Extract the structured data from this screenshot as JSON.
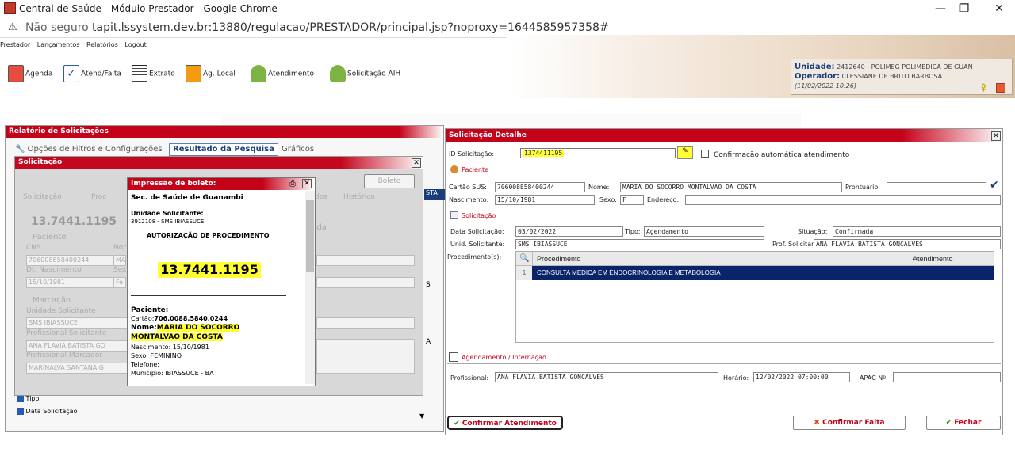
{
  "browser": {
    "window_title": "Central de Saúde - Módulo Prestador - Google Chrome",
    "not_secure": "Não seguro",
    "url": "tapit.lssystem.dev.br:13880/regulacao/PRESTADOR/principal.jsp?noproxy=1644585957358#"
  },
  "menu": {
    "items": [
      "Prestador",
      "Lançamentos",
      "Relatórios",
      "Logout"
    ]
  },
  "toolbar": {
    "agenda": "Agenda",
    "atend_falta": "Atend/Falta",
    "extrato": "Extrato",
    "ag_local": "Ag. Local",
    "atendimento": "Atendimento",
    "solicitacao_aih": "Solicitação AIH"
  },
  "unit": {
    "unidade_label": "Unidade:",
    "unidade_value": "2412640 - POLIMEG POLIMEDICA DE GUAN",
    "operador_label": "Operador:",
    "operador_value": "CLESSIANE DE BRITO BARBOSA",
    "datetime": "(11/02/2022 10:26)"
  },
  "relatorio": {
    "title": "Relatório de Solicitações",
    "tab_filtros": "Opções de Filtros e Configurações",
    "tab_resultado": "Resultado da Pesquisa",
    "tab_graficos": "Gráficos",
    "chk_tipo": "Tipo",
    "chk_data": "Data Solicitação"
  },
  "solicitacao_modal": {
    "title": "Solicitação",
    "boleto_btn": "Boleto",
    "tab_solicitacao": "Solicitação",
    "tab_proc": "Proc",
    "tab_dos": "dos",
    "tab_historico": "Histórico",
    "number": "13.7441.1195",
    "confirmada": "nfirmada",
    "paciente": "Paciente",
    "cns": "CNS",
    "cns_value": "706008858400244",
    "nome_short": "Nor",
    "nome_value": "MA",
    "dt_nasc": "Dt. Nascimento",
    "sexo_short": "Sex",
    "dt_nasc_value": "15/10/1981",
    "sexo_value": "Fe",
    "marcacao": "Marcação",
    "unid_sol": "Unidade Solicitante",
    "unid_sol_value": "SMS IBIASSUCE",
    "prof_sol": "Profissional Solicitante",
    "prof_sol_value": "ANA FLAVIA BATISTA GO",
    "prof_marc": "Profissional Marcador",
    "prof_marc_value": "MARINALVA SANTANA G"
  },
  "boleto": {
    "title": "Impressão de boleto:",
    "org": "Sec. de Saúde de Guanambi",
    "unid_label": "Unidade Solicitante:",
    "unid_value": "3912108 - SMS IBIASSUCE",
    "autorizacao": "AUTORIZAÇÃO DE PROCEDIMENTO",
    "number": "13.7441.1195",
    "paciente_label": "Paciente:",
    "cartao_label": "Cartão:",
    "cartao_value": "706.0088.5840.0244",
    "nome_label": "Nome:",
    "nome_value1": "MARIA DO SOCORRO",
    "nome_value2": "MONTALVAO DA COSTA",
    "nascimento": "Nascimento: 15/10/1981",
    "sexo": "Sexo: FEMININO",
    "telefone": "Telefone:",
    "municipio": "Municipio: IBIASSUCE - BA"
  },
  "background_fragments": {
    "sta": "STA",
    "s": "S",
    "a": "A"
  },
  "detalhe": {
    "title": "Solicitação Detalhe",
    "id_label": "ID Solicitação:",
    "id_value": "1374411195",
    "auto_confirm": "Confirmação automática atendimento",
    "paciente_section": "Paciente",
    "cartao_label": "Cartão SUS:",
    "cartao_value": "706008858400244",
    "nome_label": "Nome:",
    "nome_value": "MARIA DO SOCORRO MONTALVAO DA COSTA",
    "prontuario_label": "Prontuário:",
    "prontuario_value": "",
    "nascimento_label": "Nascimento:",
    "nascimento_value": "15/10/1981",
    "sexo_label": "Sexo:",
    "sexo_value": "F",
    "endereco_label": "Endereço:",
    "endereco_value": "",
    "solicitacao_section": "Solicitação",
    "data_sol_label": "Data Solicitação:",
    "data_sol_value": "03/02/2022",
    "tipo_label": "Tipo:",
    "tipo_value": "Agendamento",
    "situacao_label": "Situação:",
    "situacao_value": "Confirmada",
    "unid_sol_label": "Unid. Solicitante:",
    "unid_sol_value": "SMS IBIASSUCE",
    "prof_sol_label": "Prof. Solicitante:",
    "prof_sol_value": "ANA FLAVIA BATISTA GONCALVES",
    "procedimentos_label": "Procedimento(s):",
    "grid_col_proc": "Procedimento",
    "grid_col_atend": "Atendimento",
    "grid_row_num": "1",
    "grid_row_proc": "CONSULTA MEDICA EM ENDOCRINOLOGIA E METABOLOGIA",
    "grid_row_atend": "",
    "agendamento_section": "Agendamento / Internação",
    "profissional_label": "Profissional:",
    "profissional_value": "ANA FLAVIA BATISTA GONCALVES",
    "horario_label": "Horário:",
    "horario_value": "12/02/2022 07:00:00",
    "apac_label": "APAC Nº",
    "apac_value": "",
    "btn_confirmar": "Confirmar Atendimento",
    "btn_falta": "Confirmar Falta",
    "btn_fechar": "Fechar"
  },
  "colors": {
    "accent_red": "#c4031b",
    "selected_row": "#0a246a",
    "highlight_yellow": "#ffff33"
  }
}
